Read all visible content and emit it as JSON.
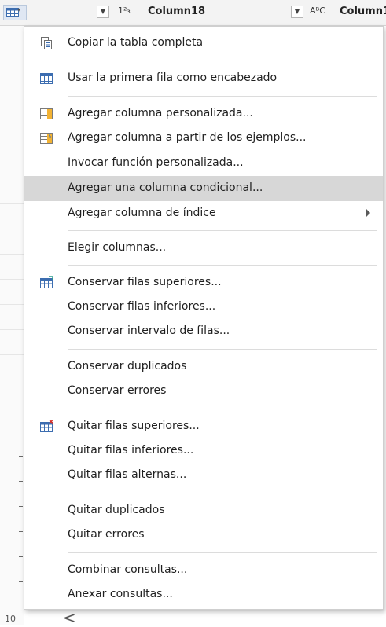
{
  "header": {
    "col1_type": "1²₃",
    "col1_title": "Column18",
    "col2_type": "AᴮC",
    "col2_title": "Column1"
  },
  "menu": {
    "items": [
      {
        "label": "Copiar la tabla completa",
        "icon": "copy-icon"
      },
      {
        "label": "Usar la primera fila como encabezado",
        "icon": "table-header-icon"
      },
      {
        "label": "Agregar columna personalizada...",
        "icon": "custom-column-icon"
      },
      {
        "label": "Agregar columna a partir de los ejemplos...",
        "icon": "column-from-examples-icon"
      },
      {
        "label": "Invocar función personalizada..."
      },
      {
        "label": "Agregar una columna condicional...",
        "highlighted": true
      },
      {
        "label": "Agregar columna de índice",
        "has_submenu": true
      },
      {
        "label": "Elegir columnas..."
      },
      {
        "label": "Conservar filas superiores...",
        "icon": "keep-rows-icon"
      },
      {
        "label": "Conservar filas inferiores..."
      },
      {
        "label": "Conservar intervalo de filas..."
      },
      {
        "label": "Conservar duplicados"
      },
      {
        "label": "Conservar errores"
      },
      {
        "label": "Quitar filas superiores...",
        "icon": "remove-rows-icon"
      },
      {
        "label": "Quitar filas inferiores..."
      },
      {
        "label": "Quitar filas alternas..."
      },
      {
        "label": "Quitar duplicados"
      },
      {
        "label": "Quitar errores"
      },
      {
        "label": "Combinar consultas..."
      },
      {
        "label": "Anexar consultas..."
      }
    ]
  },
  "footer": {
    "scroll_left": "<",
    "row_num": "10"
  },
  "colors": {
    "highlight": "#d7d7d7",
    "accent": "#2b9d8b"
  }
}
